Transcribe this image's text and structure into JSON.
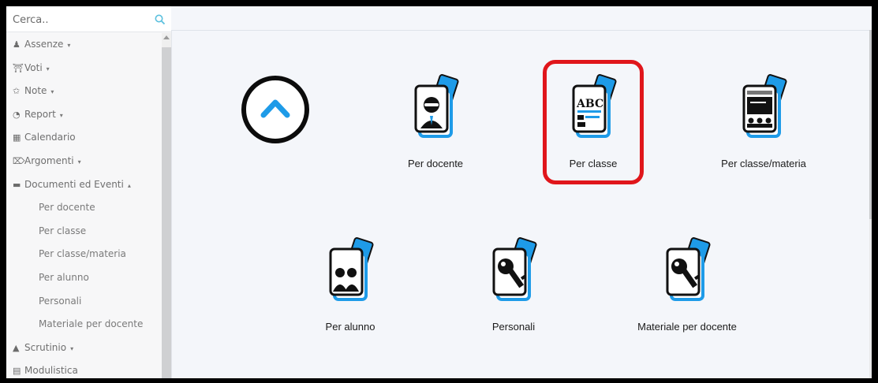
{
  "search": {
    "placeholder": "Cerca.."
  },
  "sidebar": {
    "items": [
      {
        "label": "Assenze",
        "icon": "user-icon",
        "caret": "▾"
      },
      {
        "label": "Voti",
        "icon": "bank-icon",
        "caret": "▾"
      },
      {
        "label": "Note",
        "icon": "pin-icon",
        "caret": "▾"
      },
      {
        "label": "Report",
        "icon": "pie-chart-icon",
        "caret": "▾"
      },
      {
        "label": "Calendario",
        "icon": "calendar-icon",
        "caret": ""
      },
      {
        "label": "Argomenti",
        "icon": "folder-open-icon",
        "caret": "▾"
      },
      {
        "label": "Documenti ed Eventi",
        "icon": "archive-icon",
        "caret": "▴"
      }
    ],
    "subitems": [
      "Per docente",
      "Per classe",
      "Per classe/materia",
      "Per alunno",
      "Personali",
      "Materiale per docente"
    ],
    "after": [
      {
        "label": "Scrutinio",
        "icon": "graduation-cap-icon",
        "caret": "▾"
      },
      {
        "label": "Modulistica",
        "icon": "briefcase-icon",
        "caret": ""
      }
    ]
  },
  "tiles": [
    {
      "label": "Per docente",
      "icon": "teacher-document-icon"
    },
    {
      "label": "Per classe",
      "icon": "class-document-icon"
    },
    {
      "label": "Per classe/materia",
      "icon": "class-subject-document-icon"
    },
    {
      "label": "Per alunno",
      "icon": "student-document-icon"
    },
    {
      "label": "Personali",
      "icon": "key-document-icon"
    },
    {
      "label": "Materiale per docente",
      "icon": "key-document-icon"
    }
  ],
  "colors": {
    "accent": "#1e9be8",
    "highlight": "#e0161b",
    "icon_dark": "#111111"
  }
}
